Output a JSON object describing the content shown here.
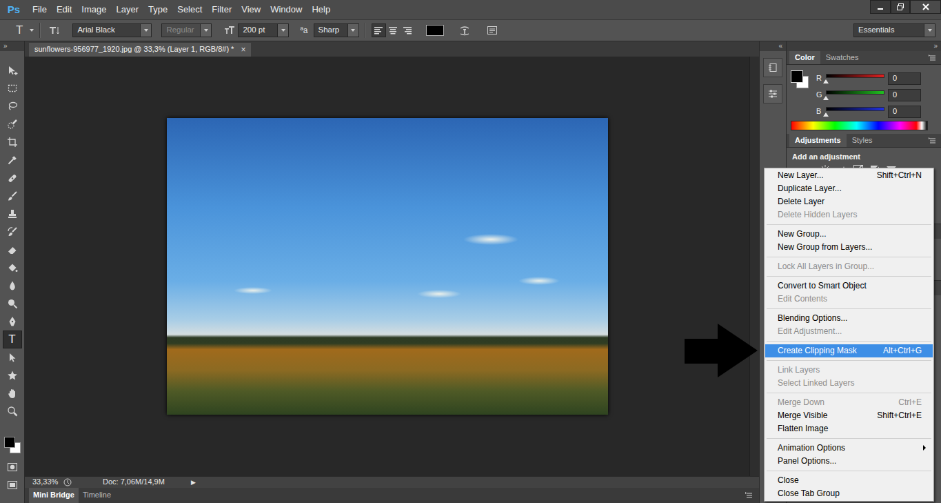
{
  "app": {
    "logo": "Ps"
  },
  "menu_bar": [
    "File",
    "Edit",
    "Image",
    "Layer",
    "Type",
    "Select",
    "Filter",
    "View",
    "Window",
    "Help"
  ],
  "options_bar": {
    "tool_glyph": "T",
    "font_family": "Arial Black",
    "font_style": {
      "value": "Regular",
      "disabled": true
    },
    "font_size": "200 pt",
    "antialias_glyph": "ªa",
    "antialias": "Sharp",
    "align": [
      {
        "selected": true
      },
      {
        "selected": false
      },
      {
        "selected": false
      }
    ],
    "workspace": "Essentials"
  },
  "collapse_glyphs": {
    "toolbar": "»",
    "strip": "«",
    "panels": "»"
  },
  "toolbar": {
    "tools": [
      {
        "selected": false
      },
      {
        "selected": false
      },
      {
        "selected": false
      },
      {
        "selected": false
      },
      {
        "selected": false
      },
      {
        "selected": false
      },
      {
        "selected": false
      },
      {
        "selected": false
      },
      {
        "selected": false
      },
      {
        "selected": false
      },
      {
        "selected": false
      },
      {
        "selected": false
      },
      {
        "selected": false
      },
      {
        "selected": false
      },
      {
        "selected": false
      },
      {
        "glyph": "T",
        "selected": true
      },
      {
        "selected": false
      },
      {
        "selected": false
      },
      {
        "selected": false
      },
      {
        "selected": false
      }
    ]
  },
  "document": {
    "tab_title": "sunflowers-956977_1920.jpg @ 33,3% (Layer 1, RGB/8#) *",
    "close": "×"
  },
  "status_bar": {
    "zoom": "33,33%",
    "doc": "Doc: 7,06M/14,9M",
    "arrow": "▶"
  },
  "bottom_tabs": [
    {
      "label": "Mini Bridge",
      "selected": true
    },
    {
      "label": "Timeline",
      "selected": false
    }
  ],
  "color_panel": {
    "tabs": [
      {
        "label": "Color",
        "selected": true
      },
      {
        "label": "Swatches",
        "selected": false
      }
    ],
    "channels": [
      {
        "name": "R",
        "value": "0",
        "level": 0,
        "color": "#e02020"
      },
      {
        "name": "G",
        "value": "0",
        "level": 0,
        "color": "#20c020"
      },
      {
        "name": "B",
        "value": "0",
        "level": 0,
        "color": "#2030e0"
      }
    ]
  },
  "adjustments_panel": {
    "tabs": [
      {
        "label": "Adjustments",
        "selected": true
      },
      {
        "label": "Styles",
        "selected": false
      }
    ],
    "title": "Add an adjustment"
  },
  "context_menu": {
    "groups": [
      [
        {
          "label": "New Layer...",
          "shortcut": "Shift+Ctrl+N",
          "disabled": false,
          "selected": false
        },
        {
          "label": "Duplicate Layer...",
          "disabled": false,
          "selected": false
        },
        {
          "label": "Delete Layer",
          "disabled": false,
          "selected": false
        },
        {
          "label": "Delete Hidden Layers",
          "disabled": true,
          "selected": false
        }
      ],
      [
        {
          "label": "New Group...",
          "disabled": false,
          "selected": false
        },
        {
          "label": "New Group from Layers...",
          "disabled": false,
          "selected": false
        }
      ],
      [
        {
          "label": "Lock All Layers in Group...",
          "disabled": true,
          "selected": false
        }
      ],
      [
        {
          "label": "Convert to Smart Object",
          "disabled": false,
          "selected": false
        },
        {
          "label": "Edit Contents",
          "disabled": true,
          "selected": false
        }
      ],
      [
        {
          "label": "Blending Options...",
          "disabled": false,
          "selected": false
        },
        {
          "label": "Edit Adjustment...",
          "disabled": true,
          "selected": false
        }
      ],
      [
        {
          "label": "Create Clipping Mask",
          "shortcut": "Alt+Ctrl+G",
          "disabled": false,
          "selected": true
        }
      ],
      [
        {
          "label": "Link Layers",
          "disabled": true,
          "selected": false
        },
        {
          "label": "Select Linked Layers",
          "disabled": true,
          "selected": false
        }
      ],
      [
        {
          "label": "Merge Down",
          "shortcut": "Ctrl+E",
          "disabled": true,
          "selected": false
        },
        {
          "label": "Merge Visible",
          "shortcut": "Shift+Ctrl+E",
          "disabled": false,
          "selected": false
        },
        {
          "label": "Flatten Image",
          "disabled": false,
          "selected": false
        }
      ],
      [
        {
          "label": "Animation Options",
          "disabled": false,
          "selected": false,
          "submenu": true
        },
        {
          "label": "Panel Options...",
          "disabled": false,
          "selected": false
        }
      ],
      [
        {
          "label": "Close",
          "disabled": false,
          "selected": false
        },
        {
          "label": "Close Tab Group",
          "disabled": false,
          "selected": false
        }
      ]
    ]
  }
}
